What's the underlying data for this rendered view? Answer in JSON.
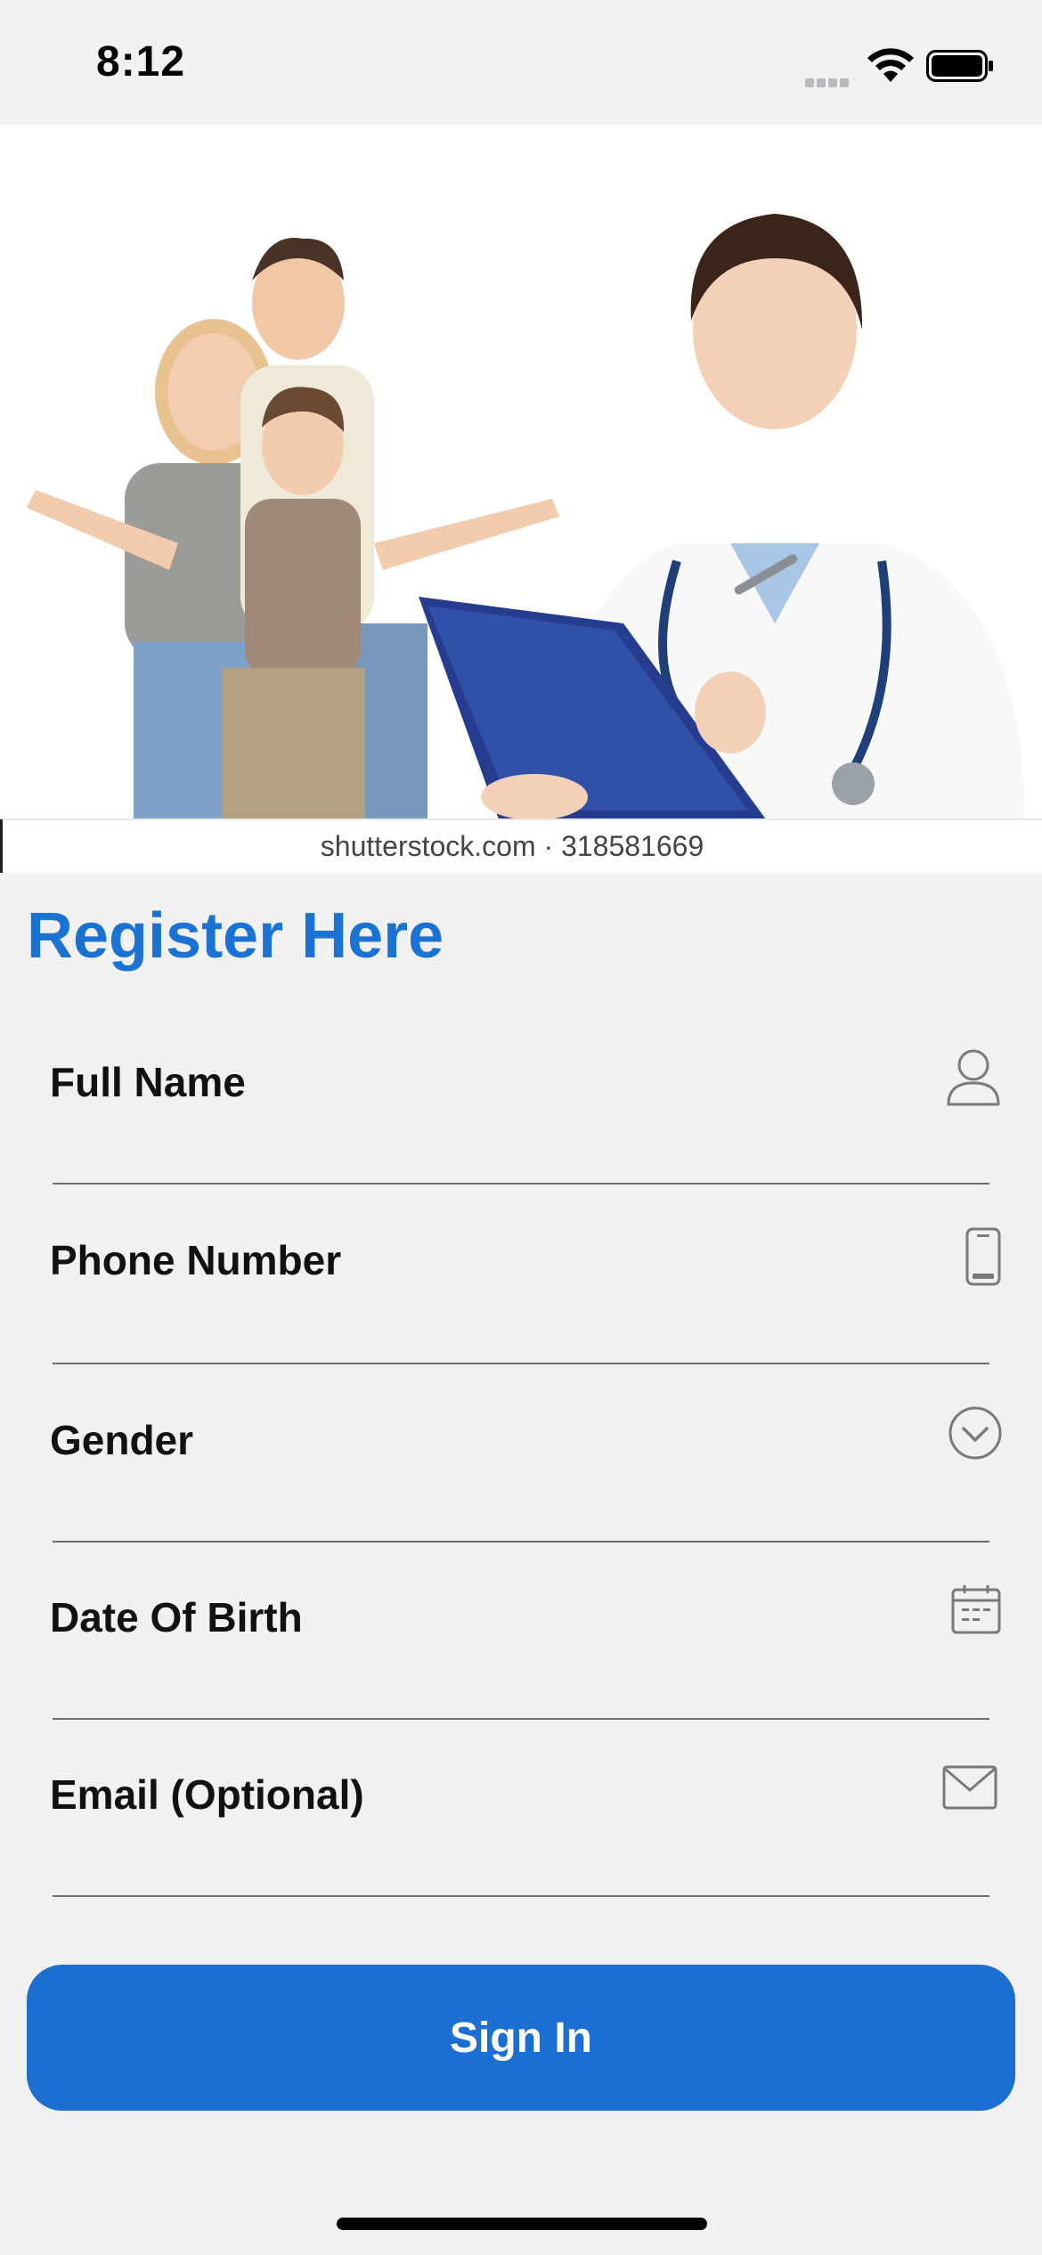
{
  "status_bar": {
    "time": "8:12"
  },
  "hero": {
    "watermark": "shutterstock.com · 318581669"
  },
  "page": {
    "title": "Register Here"
  },
  "fields": [
    {
      "label": "Full Name",
      "icon": "person-icon"
    },
    {
      "label": "Phone Number",
      "icon": "mobile-phone-icon"
    },
    {
      "label": "Gender",
      "icon": "chevron-down-circle-icon"
    },
    {
      "label": "Date Of Birth",
      "icon": "calendar-icon"
    },
    {
      "label": "Email (Optional)",
      "icon": "envelope-icon"
    }
  ],
  "actions": {
    "signin_label": "Sign In"
  },
  "colors": {
    "accent": "#1a73d3",
    "button": "#1a6fd0",
    "background": "#f1f1f2"
  }
}
